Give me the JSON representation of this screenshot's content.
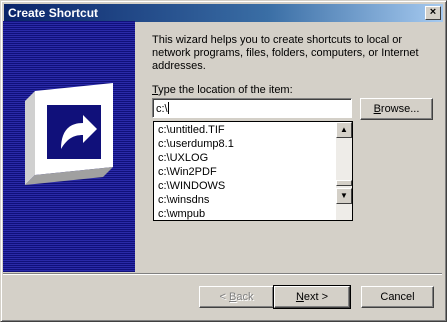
{
  "window": {
    "title": "Create Shortcut",
    "close_glyph": "×"
  },
  "intro_text": "This wizard helps you to create shortcuts to local or network programs, files, folders, computers, or Internet addresses.",
  "location": {
    "label_first": "T",
    "label_rest": "ype the location of the item:",
    "value": "c:\\"
  },
  "browse": {
    "label_first": "B",
    "label_rest": "rowse..."
  },
  "autocomplete": {
    "items": [
      "c:\\untitled.TIF",
      "c:\\userdump8.1",
      "c:\\UXLOG",
      "c:\\Win2PDF",
      "c:\\WINDOWS",
      "c:\\winsdns",
      "c:\\wmpub"
    ],
    "scroll_up_glyph": "▲",
    "scroll_down_glyph": "▼"
  },
  "nav": {
    "back_prefix": "< ",
    "back_key": "B",
    "back_rest": "ack",
    "next_key": "N",
    "next_rest": "ext >",
    "cancel": "Cancel"
  },
  "colors": {
    "titlebar": "#0a246a",
    "wizard_art": "#2a2aa8",
    "dialog": "#d4d0c8"
  },
  "icons": {
    "wizard_art_icon": "shortcut-arrow-icon"
  }
}
